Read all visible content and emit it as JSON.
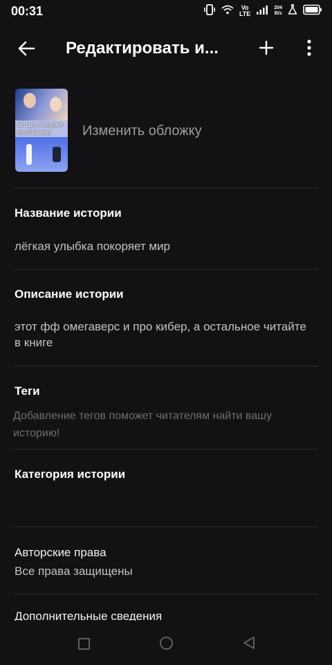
{
  "status_bar": {
    "time": "00:31",
    "volte_top": "Vo",
    "volte_bottom": "LTE",
    "speed_value": "204",
    "speed_unit": "B/s"
  },
  "toolbar": {
    "title": "Редактировать и...",
    "icons": {
      "back": "arrow-left",
      "add": "plus",
      "more": "more-vertical"
    }
  },
  "cover": {
    "thumbnail_text": "лёгкая покоряет улыбка мир",
    "change_label": "Изменить обложку"
  },
  "story": {
    "title_label": "Название истории",
    "title_value": "лёгкая улыбка покоряет мир",
    "description_label": "Описание истории",
    "description_value": "этот фф омегаверс и про кибер, а остальное читайте в книге",
    "tags_label": "Теги",
    "tags_placeholder": "Добавление тегов поможет читателям найти вашу историю!",
    "category_label": "Категория истории",
    "copyright_label": "Авторские права",
    "copyright_value": "Все права защищены",
    "extra_label": "Дополнительные сведения"
  },
  "colors": {
    "background": "#121113",
    "divider": "#2d2d2f",
    "secondary_text": "#c4c4c4",
    "placeholder_text": "#6f6f73"
  }
}
